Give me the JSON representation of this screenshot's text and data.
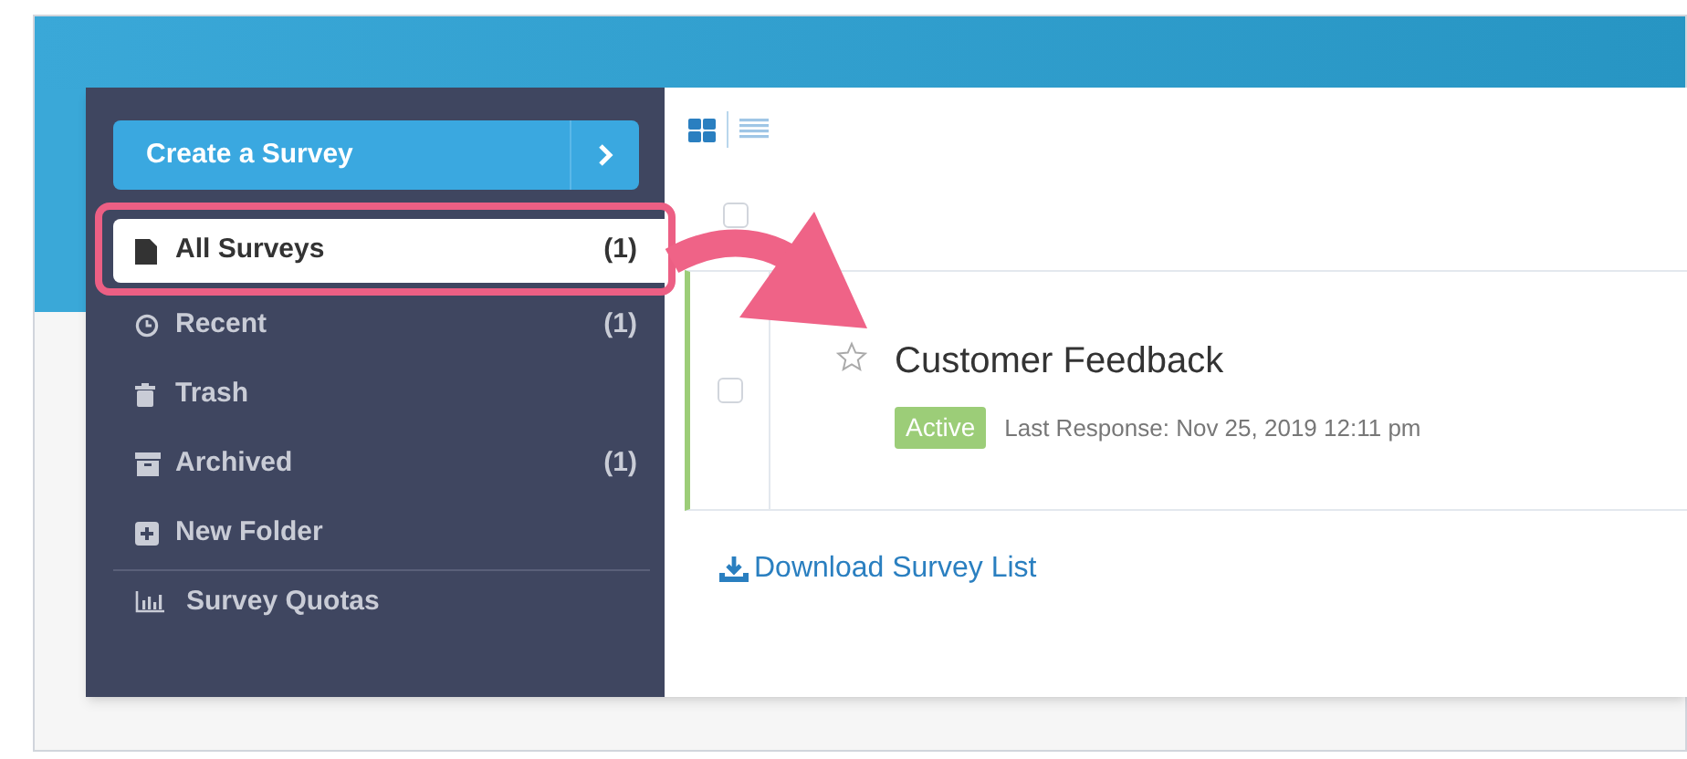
{
  "sidebar": {
    "create_button": {
      "label": "Create a Survey"
    },
    "items": [
      {
        "label": "All Surveys",
        "count": "(1)",
        "selected": true
      },
      {
        "label": "Recent",
        "count": "(1)",
        "selected": false
      },
      {
        "label": "Trash",
        "selected": false
      },
      {
        "label": "Archived",
        "count": "(1)",
        "selected": false
      },
      {
        "label": "New Folder",
        "selected": false
      }
    ],
    "footer_item": {
      "label": "Survey Quotas"
    }
  },
  "content": {
    "view_modes": [
      {
        "selected": true
      },
      {
        "selected": false
      }
    ],
    "select_all": {
      "checked": false
    },
    "surveys": [
      {
        "title": "Customer Feedback",
        "checked": false,
        "starred": false,
        "status": "Active",
        "last_response": "Last Response: Nov 25, 2019 12:11 pm"
      }
    ],
    "download_link": "Download Survey List"
  }
}
